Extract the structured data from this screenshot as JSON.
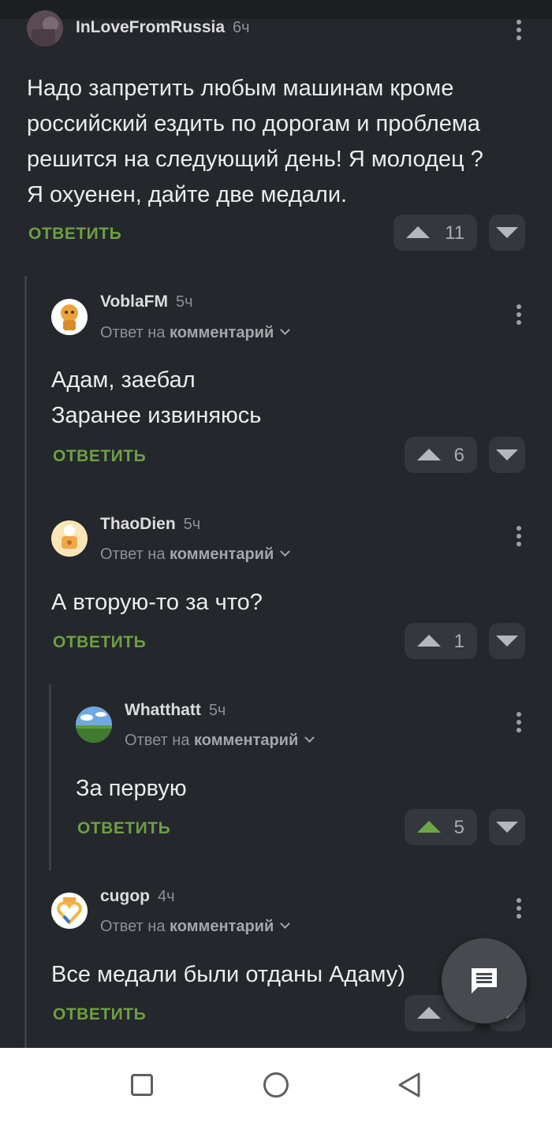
{
  "comments": [
    {
      "author": "InLoveFromRussia",
      "time": "6ч",
      "text_lines": [
        "Надо запретить любым машинам кроме",
        "российский ездить по дорогам и проблема",
        "решится на следующий день! Я молодец ?",
        "Я охуенен, дайте две медали."
      ],
      "reply_label": "ОТВЕТИТЬ",
      "votes": "11"
    },
    {
      "author": "VoblaFM",
      "time": "5ч",
      "reply_to_prefix": "Ответ на",
      "reply_to_target": "комментарий",
      "text_lines": [
        "Адам, заебал",
        "Заранее извиняюсь"
      ],
      "reply_label": "ОТВЕТИТЬ",
      "votes": "6"
    },
    {
      "author": "ThaoDien",
      "time": "5ч",
      "reply_to_prefix": "Ответ на",
      "reply_to_target": "комментарий",
      "text_lines": [
        "А вторую-то за что?"
      ],
      "reply_label": "ОТВЕТИТЬ",
      "votes": "1"
    },
    {
      "author": "Whatthatt",
      "time": "5ч",
      "reply_to_prefix": "Ответ на",
      "reply_to_target": "комментарий",
      "text_lines": [
        "За первую"
      ],
      "reply_label": "ОТВЕТИТЬ",
      "votes": "5",
      "upvoted": true
    },
    {
      "author": "cugop",
      "time": "4ч",
      "reply_to_prefix": "Ответ на",
      "reply_to_target": "комментарий",
      "text_lines": [
        "Все медали были отданы Адаму)"
      ],
      "reply_label": "ОТВЕТИТЬ",
      "votes": ""
    }
  ],
  "icons": {
    "fab": "comment-icon",
    "vote_up": "arrow-up-icon",
    "vote_down": "arrow-down-icon",
    "menu": "more-vertical-icon",
    "nav": [
      "recent-apps-icon",
      "home-icon",
      "back-icon"
    ]
  },
  "colors": {
    "background": "#24272b",
    "accent_green": "#6d9f45",
    "upvote_active": "#6aa845"
  }
}
